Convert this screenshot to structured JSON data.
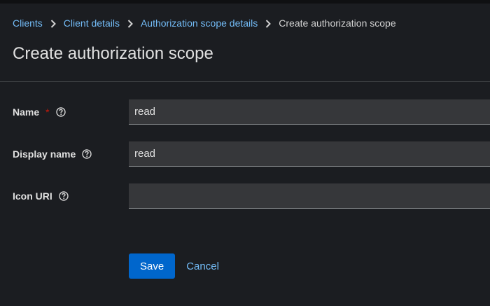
{
  "breadcrumb": {
    "items": [
      {
        "label": "Clients"
      },
      {
        "label": "Client details"
      },
      {
        "label": "Authorization scope details"
      }
    ],
    "current": "Create authorization scope"
  },
  "page": {
    "title": "Create authorization scope"
  },
  "form": {
    "name": {
      "label": "Name",
      "required_mark": "*",
      "value": "read"
    },
    "display_name": {
      "label": "Display name",
      "value": "read"
    },
    "icon_uri": {
      "label": "Icon URI",
      "value": ""
    }
  },
  "actions": {
    "save_label": "Save",
    "cancel_label": "Cancel"
  },
  "colors": {
    "background": "#1b1d21",
    "link": "#73bcf7",
    "primary": "#0066cc",
    "required": "#c9190b",
    "input_bg": "#36373a"
  },
  "icons": {
    "separator": "chevron-right-icon",
    "help": "question-circle-icon"
  }
}
